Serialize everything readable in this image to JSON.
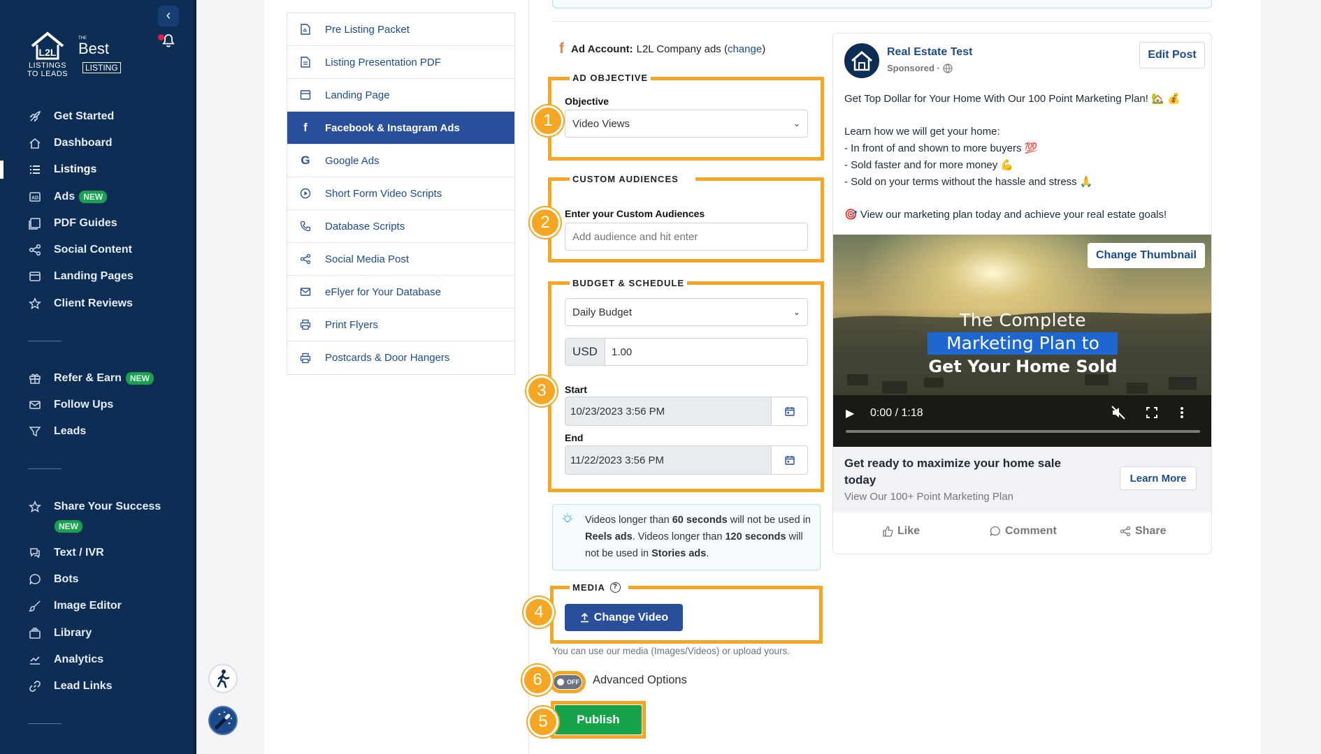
{
  "sidebar": {
    "logo_primary": "LISTINGS TO LEADS",
    "logo_primary_line1": "LISTINGS",
    "logo_primary_line2": "TO LEADS",
    "logo_secondary_the": "THE",
    "logo_secondary_best": "Best",
    "logo_secondary_listing": "LISTING",
    "collapse_icon": "chevron-left-icon",
    "notification_icon": "bell-icon",
    "group1": [
      {
        "label": "Get Started",
        "icon": "rocket-icon"
      },
      {
        "label": "Dashboard",
        "icon": "home-icon"
      },
      {
        "label": "Listings",
        "icon": "list-icon",
        "active": true
      },
      {
        "label": "Ads",
        "icon": "ad-icon",
        "badge": "NEW"
      },
      {
        "label": "PDF Guides",
        "icon": "pdf-icon"
      },
      {
        "label": "Social Content",
        "icon": "share-icon"
      },
      {
        "label": "Landing Pages",
        "icon": "browser-icon"
      },
      {
        "label": "Client Reviews",
        "icon": "star-icon"
      }
    ],
    "group2": [
      {
        "label": "Refer & Earn",
        "icon": "gift-icon",
        "badge": "NEW"
      },
      {
        "label": "Follow Ups",
        "icon": "mail-icon"
      },
      {
        "label": "Leads",
        "icon": "filter-icon"
      }
    ],
    "group3": [
      {
        "label": "Share Your Success",
        "icon": "star-outline-icon",
        "badge": "NEW"
      },
      {
        "label": "Text / IVR",
        "icon": "chat-icon"
      },
      {
        "label": "Bots",
        "icon": "bot-icon"
      },
      {
        "label": "Image Editor",
        "icon": "brush-icon"
      },
      {
        "label": "Library",
        "icon": "folder-icon"
      },
      {
        "label": "Analytics",
        "icon": "chart-icon"
      },
      {
        "label": "Lead Links",
        "icon": "link-icon"
      }
    ]
  },
  "marketing_menu": [
    {
      "label": "Pre Listing Packet",
      "icon": "pdf-file-icon"
    },
    {
      "label": "Listing Presentation PDF",
      "icon": "document-icon"
    },
    {
      "label": "Landing Page",
      "icon": "browser-icon"
    },
    {
      "label": "Facebook & Instagram Ads",
      "icon": "facebook-icon",
      "active": true
    },
    {
      "label": "Google Ads",
      "icon": "google-icon"
    },
    {
      "label": "Short Form Video Scripts",
      "icon": "play-circle-icon"
    },
    {
      "label": "Database Scripts",
      "icon": "phone-icon"
    },
    {
      "label": "Social Media Post",
      "icon": "share-icon"
    },
    {
      "label": "eFlyer for Your Database",
      "icon": "mail-icon"
    },
    {
      "label": "Print Flyers",
      "icon": "printer-icon"
    },
    {
      "label": "Postcards & Door Hangers",
      "icon": "printer-icon"
    }
  ],
  "ad_account": {
    "label": "Ad Account:",
    "name": "L2L Company ads",
    "change_link": "change"
  },
  "objective": {
    "section_title": "AD OBJECTIVE",
    "field_label": "Objective",
    "selected": "Video Views",
    "step": "1"
  },
  "audiences": {
    "section_title": "CUSTOM AUDIENCES",
    "field_label": "Enter your Custom Audiences",
    "placeholder": "Add audience and hit enter",
    "step": "2"
  },
  "budget": {
    "section_title": "BUDGET & SCHEDULE",
    "budget_type": "Daily Budget",
    "currency": "USD",
    "amount": "1.00",
    "start_label": "Start",
    "start_value": "10/23/2023 3:56 PM",
    "end_label": "End",
    "end_value": "11/22/2023 3:56 PM",
    "step": "3"
  },
  "info": {
    "text_1": "Videos longer than ",
    "bold_1": "60 seconds",
    "text_2": " will not be used in ",
    "bold_2": "Reels ads",
    "text_3": ". Videos longer than ",
    "bold_3": "120 seconds",
    "text_4": " will not be used in ",
    "bold_4": "Stories ads",
    "text_5": "."
  },
  "media": {
    "section_title": "MEDIA",
    "button_label": "Change Video",
    "hint": "You can use our media (Images/Videos) or upload yours.",
    "step": "4"
  },
  "advanced": {
    "toggle_text": "OFF",
    "label": "Advanced Options",
    "step": "6"
  },
  "publish": {
    "label": "Publish",
    "step": "5"
  },
  "preview": {
    "page_name": "Real Estate Test",
    "sponsored": "Sponsored ·",
    "edit_button": "Edit Post",
    "body": "Get Top Dollar for Your Home With Our 100 Point Marketing Plan! 🏡 💰\n\nLearn how we will get your home:\n- In front of and shown to more buyers 💯\n- Sold faster and for more money 💪\n- Sold on your terms without the hassle and stress 🙏\n\n🎯 View our marketing plan today and achieve your real estate goals!",
    "thumbnail_button": "Change Thumbnail",
    "video_title_1": "The Complete",
    "video_title_2": "Marketing Plan to",
    "video_title_3": "Get Your Home Sold",
    "video_time": "0:00 / 1:18",
    "headline": "Get ready to maximize your home sale today",
    "subline": "View Our 100+ Point Marketing Plan",
    "cta": "Learn More",
    "actions": {
      "like": "Like",
      "comment": "Comment",
      "share": "Share"
    }
  },
  "colors": {
    "sidebar": "#0d2d55",
    "accent": "#2a4f9a",
    "highlight": "#f5a623",
    "publish": "#16a34a",
    "badge": "#1e9e53"
  }
}
